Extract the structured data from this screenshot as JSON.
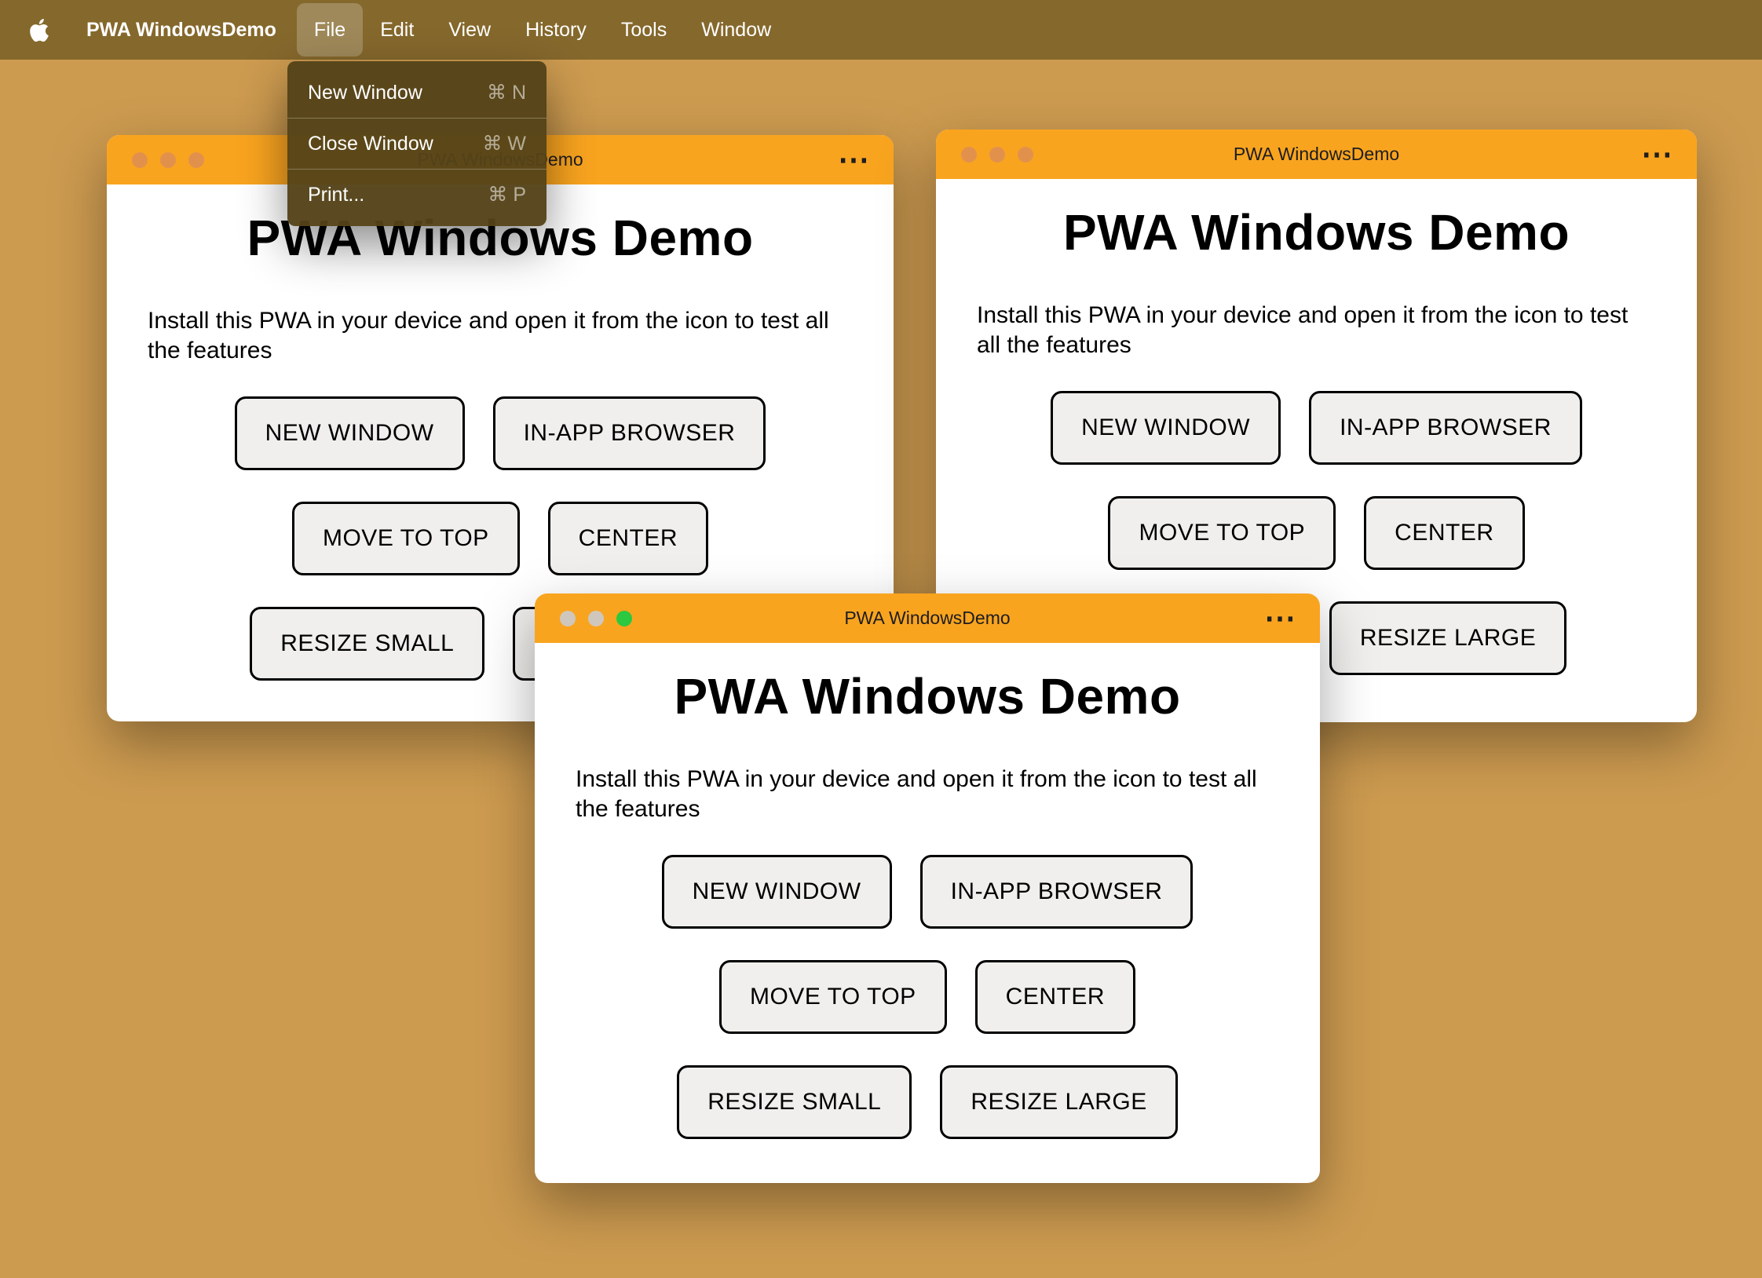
{
  "colors": {
    "desktop": "#cd9b50",
    "menubar": "#85682c",
    "titlebar": "#f9a41f",
    "window_bg": "#ffffff",
    "button_bg": "#f0efed",
    "traffic_unfocused": "#e2914d",
    "traffic_zoom_front": "#2bc840",
    "menu_bg": "#544318"
  },
  "menubar": {
    "app_name": "PWA WindowsDemo",
    "menus": [
      {
        "label": "File"
      },
      {
        "label": "Edit"
      },
      {
        "label": "View"
      },
      {
        "label": "History"
      },
      {
        "label": "Tools"
      },
      {
        "label": "Window"
      }
    ],
    "active_menu": "File"
  },
  "file_menu": {
    "items": [
      {
        "label": "New Window",
        "shortcut": "⌘ N"
      },
      {
        "label": "Close Window",
        "shortcut": "⌘ W"
      },
      {
        "label": "Print...",
        "shortcut": "⌘ P"
      }
    ]
  },
  "window": {
    "title": "PWA WindowsDemo",
    "overflow_icon": "⋯",
    "heading": "PWA Windows Demo",
    "description": "Install this PWA in your device and open it from the icon to test all the features",
    "buttons": [
      "NEW WINDOW",
      "IN-APP BROWSER",
      "MOVE TO TOP",
      "CENTER",
      "RESIZE SMALL",
      "RESIZE LARGE"
    ]
  }
}
